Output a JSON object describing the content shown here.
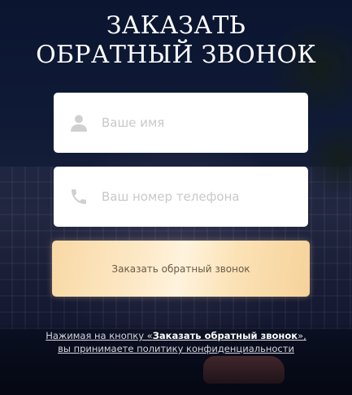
{
  "modal": {
    "title_line1": "ЗАКАЗАТЬ",
    "title_line2": "ОБРАТНЫЙ ЗВОНОК"
  },
  "form": {
    "name_placeholder": "Ваше имя",
    "phone_placeholder": "Ваш номер телефона",
    "submit_label": "Заказать обратный звонок"
  },
  "policy": {
    "prefix": "Нажимая на кнопку «",
    "button_ref": "Заказать обратный звонок",
    "suffix": "»,",
    "line2": "вы принимаете политику конфиденциальности"
  },
  "icons": {
    "name": "user-icon",
    "phone": "phone-icon"
  },
  "colors": {
    "background": "#0f1a36",
    "field_bg": "#ffffff",
    "placeholder": "#c9c9c9",
    "icon": "#d0d0d0",
    "button_gradient_start": "#f8d9a5",
    "button_gradient_mid": "#fff3dd",
    "button_text": "#6b5a44",
    "title": "#ffffff",
    "policy_text": "#d6d6de"
  }
}
